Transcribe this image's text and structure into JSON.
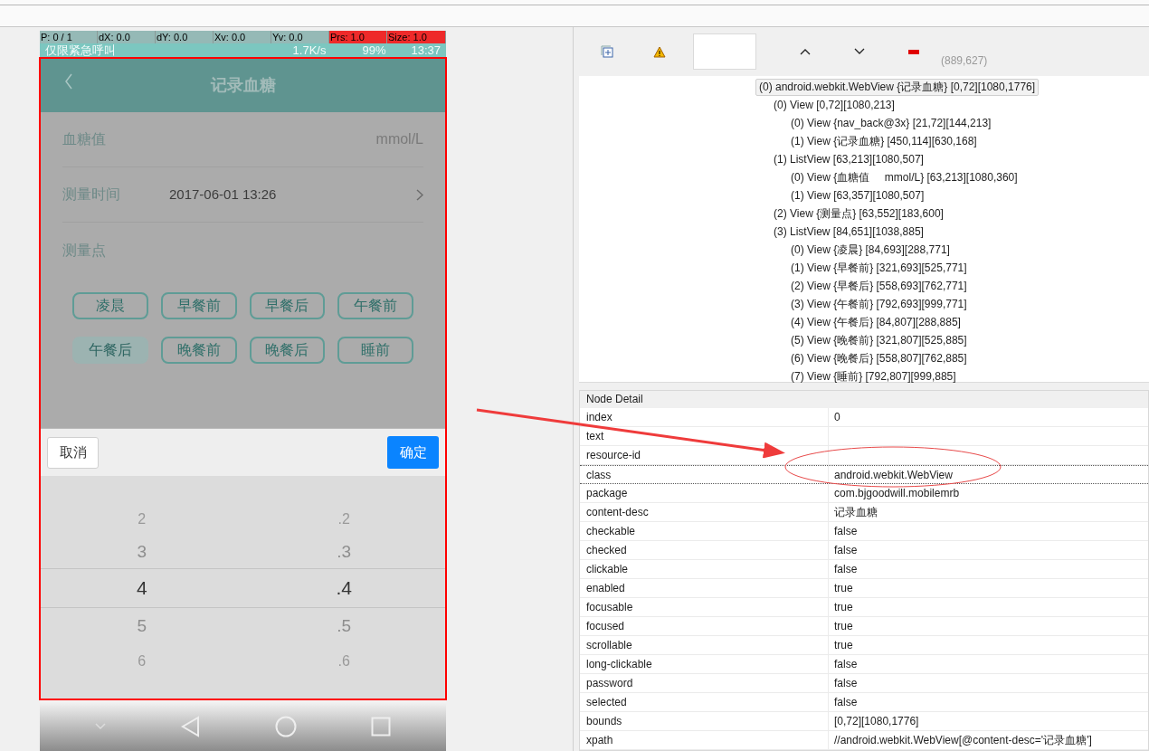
{
  "device": {
    "pointer_info": [
      {
        "text": "P: 0 / 1",
        "alert": false
      },
      {
        "text": "dX: 0.0",
        "alert": false
      },
      {
        "text": "dY: 0.0",
        "alert": false
      },
      {
        "text": "Xv: 0.0",
        "alert": false
      },
      {
        "text": "Yv: 0.0",
        "alert": false
      },
      {
        "text": "Prs: 1.0",
        "alert": true
      },
      {
        "text": "Size: 1.0",
        "alert": true
      }
    ],
    "status_bar": {
      "carrier": "仅限紧急呼叫",
      "speed": "1.7K/s",
      "battery": "99%",
      "time": "13:37"
    },
    "app_title": "记录血糖",
    "form": [
      {
        "kind": "value",
        "label": "血糖值",
        "value": "mmol/L"
      },
      {
        "kind": "picker",
        "label": "测量时间",
        "value": "2017-06-01 13:26"
      },
      {
        "kind": "header",
        "label": "测量点"
      }
    ],
    "measure_points": [
      {
        "label": "凌晨",
        "selected": false
      },
      {
        "label": "早餐前",
        "selected": false
      },
      {
        "label": "早餐后",
        "selected": false
      },
      {
        "label": "午餐前",
        "selected": false
      },
      {
        "label": "午餐后",
        "selected": true
      },
      {
        "label": "晚餐前",
        "selected": false
      },
      {
        "label": "晚餐后",
        "selected": false
      },
      {
        "label": "睡前",
        "selected": false
      }
    ],
    "picker": {
      "cancel": "取消",
      "confirm": "确定",
      "columns": [
        [
          {
            "text": "2",
            "selected": false
          },
          {
            "text": "3",
            "selected": false
          },
          {
            "text": "4",
            "selected": true
          },
          {
            "text": "5",
            "selected": false
          },
          {
            "text": "6",
            "selected": false
          }
        ],
        [
          {
            "text": ".2",
            "selected": false
          },
          {
            "text": ".3",
            "selected": false
          },
          {
            "text": ".4",
            "selected": true
          },
          {
            "text": ".5",
            "selected": false
          },
          {
            "text": ".6",
            "selected": false
          }
        ]
      ]
    }
  },
  "toolbar": {
    "coordinates": "(889,627)"
  },
  "tree": [
    {
      "text": "(0) android.webkit.WebView {记录血糖} [0,72][1080,1776]",
      "selected": true,
      "children": [
        {
          "text": "(0) View [0,72][1080,213]",
          "selected": false,
          "children": [
            {
              "text": "(0) View {nav_back@3x} [21,72][144,213]",
              "selected": false
            },
            {
              "text": "(1) View {记录血糖} [450,114][630,168]",
              "selected": false
            }
          ]
        },
        {
          "text": "(1) ListView [63,213][1080,507]",
          "selected": false,
          "children": [
            {
              "text": "(0) View {血糖值     mmol/L} [63,213][1080,360]",
              "selected": false
            },
            {
              "text": "(1) View [63,357][1080,507]",
              "selected": false
            }
          ]
        },
        {
          "text": "(2) View {测量点} [63,552][183,600]",
          "selected": false
        },
        {
          "text": "(3) ListView [84,651][1038,885]",
          "selected": false,
          "children": [
            {
              "text": "(0) View {凌晨} [84,693][288,771]",
              "selected": false
            },
            {
              "text": "(1) View {早餐前} [321,693][525,771]",
              "selected": false
            },
            {
              "text": "(2) View {早餐后} [558,693][762,771]",
              "selected": false
            },
            {
              "text": "(3) View {午餐前} [792,693][999,771]",
              "selected": false
            },
            {
              "text": "(4) View {午餐后} [84,807][288,885]",
              "selected": false
            },
            {
              "text": "(5) View {晚餐前} [321,807][525,885]",
              "selected": false
            },
            {
              "text": "(6) View {晚餐后} [558,807][762,885]",
              "selected": false
            },
            {
              "text": "(7) View {睡前} [792,807][999,885]",
              "selected": false
            }
          ]
        }
      ]
    }
  ],
  "node_detail": {
    "title": "Node Detail",
    "rows": [
      {
        "key": "index",
        "value": "0",
        "selected": false
      },
      {
        "key": "text",
        "selected": false
      },
      {
        "key": "resource-id",
        "selected": false
      },
      {
        "key": "class",
        "value": "android.webkit.WebView",
        "selected": true
      },
      {
        "key": "package",
        "value": "com.bjgoodwill.mobilemrb",
        "selected": false
      },
      {
        "key": "content-desc",
        "value": "记录血糖",
        "selected": false
      },
      {
        "key": "checkable",
        "value": "false",
        "selected": false
      },
      {
        "key": "checked",
        "value": "false",
        "selected": false
      },
      {
        "key": "clickable",
        "value": "false",
        "selected": false
      },
      {
        "key": "enabled",
        "value": "true",
        "selected": false
      },
      {
        "key": "focusable",
        "value": "true",
        "selected": false
      },
      {
        "key": "focused",
        "value": "true",
        "selected": false
      },
      {
        "key": "scrollable",
        "value": "true",
        "selected": false
      },
      {
        "key": "long-clickable",
        "value": "false",
        "selected": false
      },
      {
        "key": "password",
        "value": "false",
        "selected": false
      },
      {
        "key": "selected",
        "value": "false",
        "selected": false
      },
      {
        "key": "bounds",
        "value": "[0,72][1080,1776]",
        "selected": false
      },
      {
        "key": "xpath",
        "value": "//android.webkit.WebView[@content-desc='记录血糖']",
        "selected": false
      }
    ]
  }
}
